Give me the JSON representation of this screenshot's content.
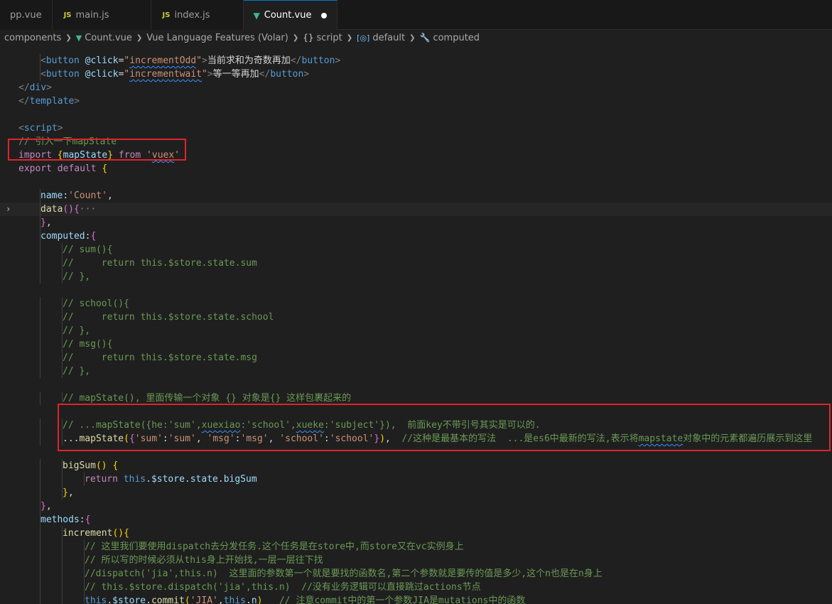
{
  "tabs": [
    {
      "label": "pp.vue",
      "icon": "vue-icon",
      "active": false
    },
    {
      "label": "main.js",
      "icon": "js-icon",
      "active": false
    },
    {
      "label": "index.js",
      "icon": "js-icon",
      "active": false
    },
    {
      "label": "Count.vue",
      "icon": "vue-icon",
      "active": true,
      "dirty": true
    }
  ],
  "tab_icons": {
    "js_text": "JS",
    "vue_glyph": "▼"
  },
  "breadcrumb": {
    "items": [
      {
        "label": "components",
        "icon": ""
      },
      {
        "label": "Count.vue",
        "icon": "vue-icon"
      },
      {
        "label": "Vue Language Features (Volar)",
        "icon": ""
      },
      {
        "label": "script",
        "icon": "braces-icon"
      },
      {
        "label": "default",
        "icon": "module-icon"
      },
      {
        "label": "computed",
        "icon": "wrench-icon"
      }
    ],
    "separator": "❯"
  },
  "colors": {
    "background": "#1f1f1f",
    "tab_bar": "#181818",
    "comment": "#6a9955",
    "keyword": "#c586c0",
    "string": "#ce9178",
    "variable": "#9cdcfe",
    "function": "#dcdcaa",
    "tag": "#569cd6",
    "highlight_box": "#e0232b"
  },
  "editor": {
    "lines": [
      {
        "indent": 0,
        "tokens": []
      },
      {
        "indent": 2,
        "tokens": [
          [
            "<",
            "bracket"
          ],
          [
            "button",
            "tag"
          ],
          [
            " ",
            "text"
          ],
          [
            "@click",
            "attr"
          ],
          [
            "=",
            "text"
          ],
          [
            "\"",
            "str"
          ],
          [
            "incrementOdd",
            "str",
            "squiggle"
          ],
          [
            "\"",
            "str"
          ],
          [
            ">",
            "bracket"
          ],
          [
            "当前求和为奇数再加",
            "text"
          ],
          [
            "</",
            "bracket"
          ],
          [
            "button",
            "tag"
          ],
          [
            ">",
            "bracket"
          ]
        ]
      },
      {
        "indent": 2,
        "tokens": [
          [
            "<",
            "bracket"
          ],
          [
            "button",
            "tag"
          ],
          [
            " ",
            "text"
          ],
          [
            "@click",
            "attr"
          ],
          [
            "=",
            "text"
          ],
          [
            "\"",
            "str"
          ],
          [
            "incrementwait",
            "str",
            "squiggle"
          ],
          [
            "\"",
            "str"
          ],
          [
            ">",
            "bracket"
          ],
          [
            "等一等再加",
            "text"
          ],
          [
            "</",
            "bracket"
          ],
          [
            "button",
            "tag"
          ],
          [
            ">",
            "bracket"
          ]
        ]
      },
      {
        "indent": 1,
        "tokens": [
          [
            "</",
            "bracket"
          ],
          [
            "div",
            "tag"
          ],
          [
            ">",
            "bracket"
          ]
        ]
      },
      {
        "indent": 0,
        "tokens": [
          [
            "</",
            "bracket"
          ],
          [
            "template",
            "tag"
          ],
          [
            ">",
            "bracket"
          ]
        ]
      },
      {
        "indent": 0,
        "tokens": []
      },
      {
        "indent": 0,
        "tokens": [
          [
            "<",
            "bracket"
          ],
          [
            "script",
            "tag"
          ],
          [
            ">",
            "bracket"
          ]
        ]
      },
      {
        "indent": 0,
        "tokens": [
          [
            "// 引入一下mapState",
            "cmt"
          ]
        ]
      },
      {
        "indent": 0,
        "tokens": [
          [
            "import",
            "kw"
          ],
          [
            " ",
            "text"
          ],
          [
            "{",
            "brace"
          ],
          [
            "mapState",
            "var"
          ],
          [
            "}",
            "brace"
          ],
          [
            " ",
            "text"
          ],
          [
            "from",
            "kw"
          ],
          [
            " ",
            "text"
          ],
          [
            "'",
            "str"
          ],
          [
            "vuex",
            "str",
            "squiggle"
          ],
          [
            "'",
            "str"
          ]
        ]
      },
      {
        "indent": 0,
        "tokens": [
          [
            "export",
            "kw"
          ],
          [
            " ",
            "text"
          ],
          [
            "default",
            "kw"
          ],
          [
            " ",
            "text"
          ],
          [
            "{",
            "brace"
          ]
        ]
      },
      {
        "indent": 0,
        "tokens": []
      },
      {
        "indent": 2,
        "tokens": [
          [
            "name",
            "prop"
          ],
          [
            ":",
            "punc"
          ],
          [
            "'Count'",
            "str"
          ],
          [
            ",",
            "punc"
          ]
        ]
      },
      {
        "indent": 2,
        "fold": true,
        "current": true,
        "tokens": [
          [
            "data",
            "fn"
          ],
          [
            "()",
            "brace2"
          ],
          [
            "{",
            "brace2"
          ],
          [
            "···",
            "fold"
          ]
        ]
      },
      {
        "indent": 2,
        "tokens": [
          [
            "}",
            "brace2"
          ],
          [
            ",",
            "punc"
          ]
        ]
      },
      {
        "indent": 2,
        "tokens": [
          [
            "computed",
            "prop"
          ],
          [
            ":",
            "punc"
          ],
          [
            "{",
            "brace2"
          ]
        ]
      },
      {
        "indent": 3,
        "tokens": [
          [
            "// sum(){",
            "cmt"
          ]
        ]
      },
      {
        "indent": 3,
        "tokens": [
          [
            "//     return this.$store.state.sum",
            "cmt"
          ]
        ]
      },
      {
        "indent": 3,
        "tokens": [
          [
            "// },",
            "cmt"
          ]
        ]
      },
      {
        "indent": 0,
        "tokens": []
      },
      {
        "indent": 3,
        "tokens": [
          [
            "// school(){",
            "cmt"
          ]
        ]
      },
      {
        "indent": 3,
        "tokens": [
          [
            "//     return this.$store.state.school",
            "cmt"
          ]
        ]
      },
      {
        "indent": 3,
        "tokens": [
          [
            "// },",
            "cmt"
          ]
        ]
      },
      {
        "indent": 3,
        "tokens": [
          [
            "// msg(){",
            "cmt"
          ]
        ]
      },
      {
        "indent": 3,
        "tokens": [
          [
            "//     return this.$store.state.msg",
            "cmt"
          ]
        ]
      },
      {
        "indent": 3,
        "tokens": [
          [
            "// },",
            "cmt"
          ]
        ]
      },
      {
        "indent": 0,
        "tokens": []
      },
      {
        "indent": 3,
        "tokens": [
          [
            "// mapState(), 里面传输一个对象 {} 对象是{} 这样包裹起来的",
            "cmt"
          ]
        ]
      },
      {
        "indent": 0,
        "tokens": []
      },
      {
        "indent": 3,
        "tokens": [
          [
            "// ...mapState({he:'sum',",
            "cmt"
          ],
          [
            "xuexiao",
            "cmt",
            "squiggle"
          ],
          [
            ":'school',",
            "cmt"
          ],
          [
            "xueke",
            "cmt",
            "squiggle"
          ],
          [
            ":'subject'}),  前面key不带引号其实是可以的.",
            "cmt"
          ]
        ]
      },
      {
        "indent": 3,
        "tokens": [
          [
            "...",
            "punc"
          ],
          [
            "mapState",
            "fn"
          ],
          [
            "(",
            "brace"
          ],
          [
            "{",
            "brace2"
          ],
          [
            "'sum'",
            "str"
          ],
          [
            ":",
            "punc"
          ],
          [
            "'sum'",
            "str"
          ],
          [
            ", ",
            "punc"
          ],
          [
            "'msg'",
            "str"
          ],
          [
            ":",
            "punc"
          ],
          [
            "'msg'",
            "str"
          ],
          [
            ", ",
            "punc"
          ],
          [
            "'school'",
            "str"
          ],
          [
            ":",
            "punc"
          ],
          [
            "'school'",
            "str"
          ],
          [
            "}",
            "brace2"
          ],
          [
            ")",
            "brace"
          ],
          [
            ",  ",
            "punc"
          ],
          [
            "//这种是最基本的写法  ...是es6中最新的写法,表示将",
            "cmt"
          ],
          [
            "mapstate",
            "cmt",
            "squiggle"
          ],
          [
            "对象中的元素都遍历展示到这里",
            "cmt"
          ]
        ]
      },
      {
        "indent": 0,
        "tokens": []
      },
      {
        "indent": 3,
        "tokens": [
          [
            "bigSum",
            "fn"
          ],
          [
            "()",
            "brace"
          ],
          [
            " ",
            "text"
          ],
          [
            "{",
            "brace"
          ]
        ]
      },
      {
        "indent": 4,
        "tokens": [
          [
            "return",
            "kw"
          ],
          [
            " ",
            "text"
          ],
          [
            "this",
            "this"
          ],
          [
            ".",
            "punc"
          ],
          [
            "$store",
            "var"
          ],
          [
            ".",
            "punc"
          ],
          [
            "state",
            "var"
          ],
          [
            ".",
            "punc"
          ],
          [
            "bigSum",
            "var"
          ]
        ]
      },
      {
        "indent": 3,
        "tokens": [
          [
            "}",
            "brace"
          ],
          [
            ",",
            "punc"
          ]
        ]
      },
      {
        "indent": 2,
        "tokens": [
          [
            "}",
            "brace2"
          ],
          [
            ",",
            "punc"
          ]
        ]
      },
      {
        "indent": 2,
        "tokens": [
          [
            "methods",
            "prop"
          ],
          [
            ":",
            "punc"
          ],
          [
            "{",
            "brace2"
          ]
        ]
      },
      {
        "indent": 3,
        "tokens": [
          [
            "increment",
            "fn"
          ],
          [
            "()",
            "brace"
          ],
          [
            "{",
            "brace"
          ]
        ]
      },
      {
        "indent": 4,
        "tokens": [
          [
            "// 这里我们要使用dispatch去分发任务.这个任务是在store中,而store又在vc实例身上",
            "cmt"
          ]
        ]
      },
      {
        "indent": 4,
        "tokens": [
          [
            "// 所以写的时候必须从this身上开始找,一层一层往下找",
            "cmt"
          ]
        ]
      },
      {
        "indent": 4,
        "tokens": [
          [
            "//dispatch('jia',this.n)  这里面的参数第一个就是要找的函数名,第二个参数就是要传的值是多少,这个n也是在n身上",
            "cmt"
          ]
        ]
      },
      {
        "indent": 4,
        "tokens": [
          [
            "// this.$store.dispatch('jia',this.n)  //没有业务逻辑可以直接跳过actions节点",
            "cmt"
          ]
        ]
      },
      {
        "indent": 4,
        "tokens": [
          [
            "this",
            "this"
          ],
          [
            ".",
            "punc"
          ],
          [
            "$store",
            "var"
          ],
          [
            ".",
            "punc"
          ],
          [
            "commit",
            "fn"
          ],
          [
            "(",
            "brace"
          ],
          [
            "'JIA'",
            "str"
          ],
          [
            ",",
            "punc"
          ],
          [
            "this",
            "this"
          ],
          [
            ".",
            "punc"
          ],
          [
            "n",
            "var"
          ],
          [
            ")",
            "brace"
          ],
          [
            "   ",
            "text"
          ],
          [
            "// 注意commit中的第一个参数JIA是mutations中的函数",
            "cmt"
          ]
        ]
      }
    ]
  }
}
